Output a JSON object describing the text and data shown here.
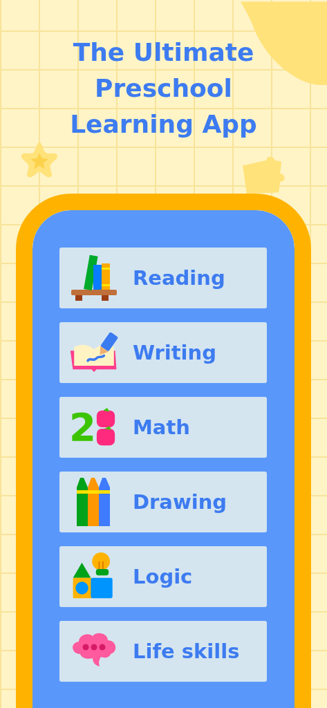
{
  "headline": "The Ultimate Preschool Learning App",
  "subjects": [
    {
      "label": "Reading",
      "kind": "books"
    },
    {
      "label": "Writing",
      "kind": "writing"
    },
    {
      "label": "Math",
      "kind": "math",
      "number": "2"
    },
    {
      "label": "Drawing",
      "kind": "crayons"
    },
    {
      "label": "Logic",
      "kind": "logic"
    },
    {
      "label": "Life skills",
      "kind": "chat"
    }
  ]
}
